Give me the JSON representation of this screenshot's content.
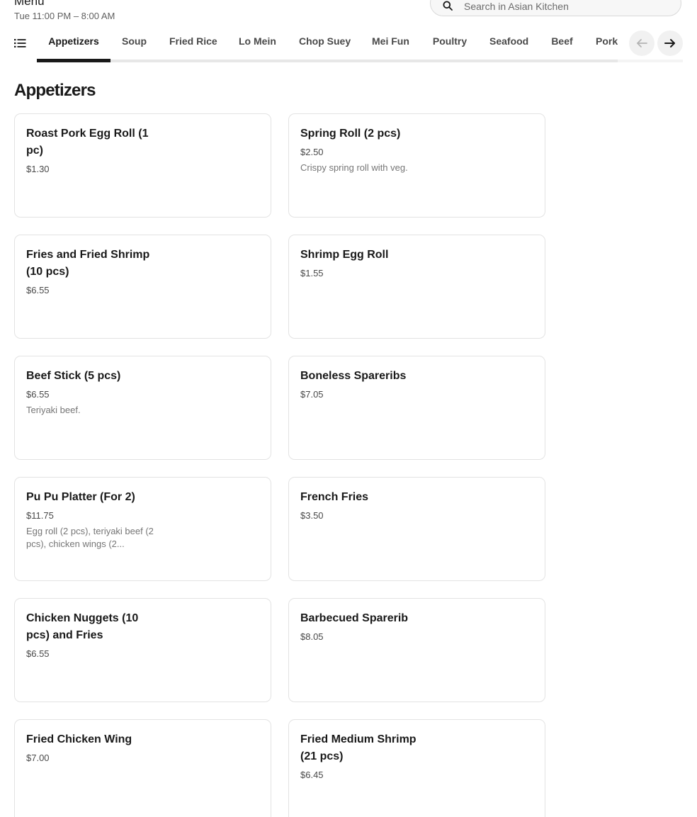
{
  "header": {
    "title": "Menu",
    "hours": "Tue 11:00 PM – 8:00 AM"
  },
  "search": {
    "placeholder": "Search in Asian Kitchen",
    "value": ""
  },
  "tabs": [
    {
      "label": "Appetizers",
      "active": true
    },
    {
      "label": "Soup"
    },
    {
      "label": "Fried Rice"
    },
    {
      "label": "Lo Mein"
    },
    {
      "label": "Chop Suey"
    },
    {
      "label": "Mei Fun"
    },
    {
      "label": "Poultry"
    },
    {
      "label": "Seafood"
    },
    {
      "label": "Beef"
    },
    {
      "label": "Pork"
    }
  ],
  "section": {
    "title": "Appetizers"
  },
  "items": [
    {
      "name": "Roast Pork Egg Roll (1 pc)",
      "price": "$1.30",
      "desc": ""
    },
    {
      "name": "Spring Roll (2 pcs)",
      "price": "$2.50",
      "desc": "Crispy spring roll with veg."
    },
    {
      "name": "Fries and Fried Shrimp (10 pcs)",
      "price": "$6.55",
      "desc": ""
    },
    {
      "name": "Shrimp Egg Roll",
      "price": "$1.55",
      "desc": ""
    },
    {
      "name": "Beef Stick (5 pcs)",
      "price": "$6.55",
      "desc": "Teriyaki beef."
    },
    {
      "name": "Boneless Spareribs",
      "price": "$7.05",
      "desc": ""
    },
    {
      "name": "Pu Pu Platter (For 2)",
      "price": "$11.75",
      "desc": "Egg roll (2 pcs), teriyaki beef (2 pcs), chicken wings (2..."
    },
    {
      "name": "French Fries",
      "price": "$3.50",
      "desc": ""
    },
    {
      "name": "Chicken Nuggets (10 pcs) and Fries",
      "price": "$6.55",
      "desc": ""
    },
    {
      "name": "Barbecued Sparerib",
      "price": "$8.05",
      "desc": ""
    },
    {
      "name": "Fried Chicken Wing",
      "price": "$7.00",
      "desc": ""
    },
    {
      "name": "Fried Medium Shrimp (21 pcs)",
      "price": "$6.45",
      "desc": ""
    }
  ],
  "icons": {
    "search": "search-icon",
    "toc": "list-icon",
    "prev": "arrow-left-icon",
    "next": "arrow-right-icon"
  },
  "colors": {
    "text": "#191919",
    "muted": "#767676",
    "border": "#e3e3e3",
    "accent": "#191919"
  }
}
